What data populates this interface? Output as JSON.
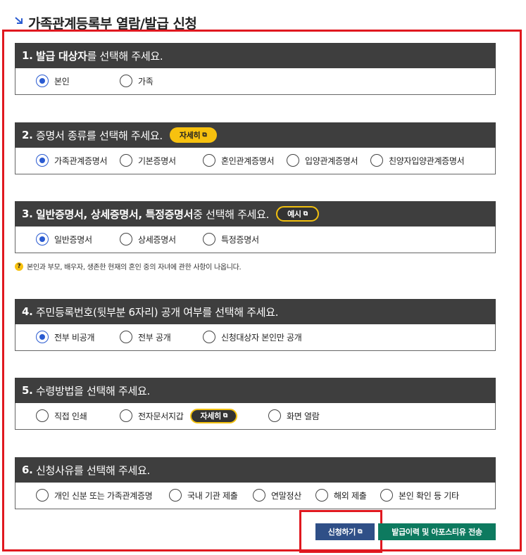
{
  "page": {
    "title": "가족관계등록부 열람/발급 신청"
  },
  "sections": [
    {
      "number": "1.",
      "highlight": "발급 대상자",
      "rest": "를 선택해 주세요.",
      "options": [
        {
          "label": "본인",
          "checked": true
        },
        {
          "label": "가족",
          "checked": false
        }
      ]
    },
    {
      "number": "2.",
      "highlight": "증명서 종류",
      "rest": "를 선택해 주세요.",
      "pill": "자세히",
      "options": [
        {
          "label": "가족관계증명서",
          "checked": true
        },
        {
          "label": "기본증명서",
          "checked": false
        },
        {
          "label": "혼인관계증명서",
          "checked": false
        },
        {
          "label": "입양관계증명서",
          "checked": false
        },
        {
          "label": "친양자입양관계증명서",
          "checked": false
        }
      ]
    },
    {
      "number": "3.",
      "highlight": "일반증명서, 상세증명서, 특정증명서",
      "rest": " 중 선택해 주세요.",
      "pill": "예시",
      "options": [
        {
          "label": "일반증명서",
          "checked": true
        },
        {
          "label": "상세증명서",
          "checked": false
        },
        {
          "label": "특정증명서",
          "checked": false
        }
      ]
    },
    {
      "number": "4.",
      "highlight": "주민등록번호(뒷부분 6자리) 공개 여부",
      "rest": "를 선택해 주세요.",
      "options": [
        {
          "label": "전부 비공개",
          "checked": true
        },
        {
          "label": "전부 공개",
          "checked": false
        },
        {
          "label": "신청대상자 본인만 공개",
          "checked": false
        }
      ]
    },
    {
      "number": "5.",
      "highlight": "수령방법",
      "rest": "을 선택해 주세요.",
      "options": [
        {
          "label": "직접 인쇄",
          "checked": false
        },
        {
          "label": "전자문서지갑",
          "checked": false
        },
        {
          "label": "화면 열람",
          "checked": false
        }
      ],
      "inline_pill": "자세히"
    },
    {
      "number": "6.",
      "highlight": "신청사유",
      "rest": "를 선택해 주세요.",
      "options": [
        {
          "label": "개인 신분 또는 가족관계증명",
          "checked": false
        },
        {
          "label": "국내 기관 제출",
          "checked": false
        },
        {
          "label": "연말정산",
          "checked": false
        },
        {
          "label": "해외 제출",
          "checked": false
        },
        {
          "label": "본인 확인 등 기타",
          "checked": false
        }
      ]
    }
  ],
  "note": {
    "icon": "?",
    "text": "본인과 부모, 배우자, 생존한 현재의 혼인 중의 자녀에 관한 사항이 나옵니다."
  },
  "buttons": {
    "apply": "신청하기",
    "send": "발급이력 및 아포스티유 전송"
  },
  "colors": {
    "header_bg": "#3e3e3e",
    "radio_selected": "#2a5bd1",
    "pill_yellow": "#f7c10f",
    "frame_red": "#e0181f",
    "apply_btn": "#2f4f87",
    "send_btn": "#0d7a5f"
  }
}
